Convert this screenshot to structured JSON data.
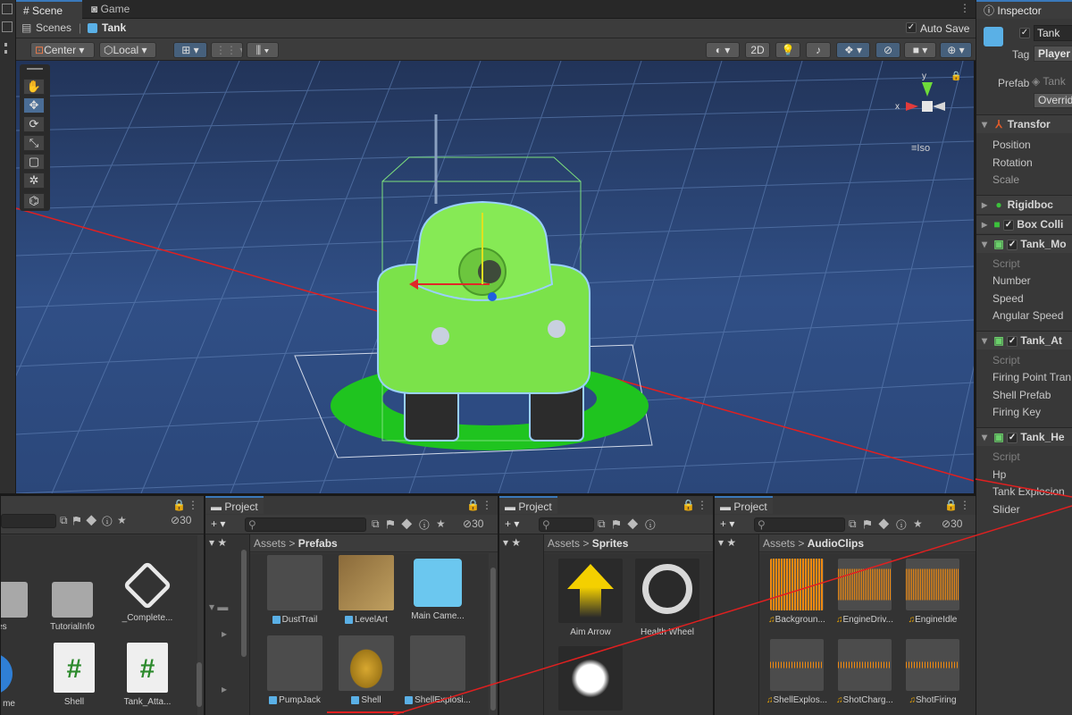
{
  "scene_window": {
    "tabs": [
      "Scene",
      "Game"
    ],
    "breadcrumb_root": "Scenes",
    "breadcrumb_sep": "|",
    "breadcrumb_prefab": "Tank",
    "auto_save_label": "Auto Save",
    "auto_save_checked": true,
    "toolbar": {
      "pivot_mode": "Center",
      "space_mode": "Local",
      "two_d_label": "2D"
    },
    "gizmo": {
      "x_label": "x",
      "y_label": "y",
      "projection": "Iso"
    }
  },
  "inspector": {
    "tab_label": "Inspector",
    "object_name": "Tank",
    "object_active": true,
    "tag_label": "Tag",
    "tag_value": "Player",
    "prefab_label": "Prefab",
    "prefab_value": "Tank",
    "overrides_label": "Overrid",
    "transform": {
      "title": "Transfor",
      "fields": [
        "Position",
        "Rotation",
        "Scale"
      ]
    },
    "components": [
      "Rigidboc",
      "Box Colli"
    ],
    "tank_movement": {
      "title": "Tank_Mo",
      "fields": [
        "Script",
        "Number",
        "Speed",
        "Angular Speed"
      ]
    },
    "tank_attack": {
      "title": "Tank_At",
      "fields": [
        "Script",
        "Firing Point Tran",
        "Shell Prefab",
        "Firing Key"
      ]
    },
    "tank_health": {
      "title": "Tank_He",
      "fields": [
        "Script",
        "Hp",
        "Tank Explosion",
        "Slider"
      ]
    }
  },
  "projects": {
    "tab_label": "Project",
    "hidden_count": "30",
    "root_panel": {
      "items": [
        {
          "label": "tes",
          "icon": "folder-icon"
        },
        {
          "label": "TutorialInfo",
          "icon": "folder-icon"
        },
        {
          "label": "_Complete...",
          "icon": "unity-logo-icon"
        },
        {
          "label": "me",
          "icon": "info-icon"
        },
        {
          "label": "Shell",
          "icon": "csharp-script-icon"
        },
        {
          "label": "Tank_Atta...",
          "icon": "csharp-script-icon"
        }
      ]
    },
    "prefabs_panel": {
      "path_root": "Assets",
      "path_leaf": "Prefabs",
      "items": [
        {
          "label": "DustTrail",
          "icon": "prefab-icon"
        },
        {
          "label": "LevelArt",
          "icon": "prefab-icon"
        },
        {
          "label": "Main Came...",
          "icon": "camera-prefab-icon"
        },
        {
          "label": "PumpJack",
          "icon": "prefab-icon"
        },
        {
          "label": "Shell",
          "icon": "prefab-icon"
        },
        {
          "label": "ShellExplosi...",
          "icon": "prefab-icon"
        }
      ]
    },
    "sprites_panel": {
      "path_root": "Assets",
      "path_leaf": "Sprites",
      "items": [
        {
          "label": "Aim Arrow",
          "icon": "arrow-sprite-icon"
        },
        {
          "label": "Health Wheel",
          "icon": "ring-sprite-icon"
        },
        {
          "label": "",
          "icon": "circle-sprite-icon"
        }
      ]
    },
    "audio_panel": {
      "path_root": "Assets",
      "path_leaf": "AudioClips",
      "items": [
        {
          "label": "Backgroun...",
          "icon": "waveform-icon"
        },
        {
          "label": "EngineDriv...",
          "icon": "waveform-icon"
        },
        {
          "label": "EngineIdle",
          "icon": "waveform-icon"
        },
        {
          "label": "ShellExplos...",
          "icon": "waveform-icon"
        },
        {
          "label": "ShotCharg...",
          "icon": "waveform-icon"
        },
        {
          "label": "ShotFiring",
          "icon": "waveform-icon"
        }
      ]
    }
  },
  "colors": {
    "accent": "#3a79bb",
    "tank_green": "#7be24a",
    "selection_outline": "#9ad0ff",
    "ground_circle": "#22cc22",
    "audio_wave": "#f08a10"
  }
}
